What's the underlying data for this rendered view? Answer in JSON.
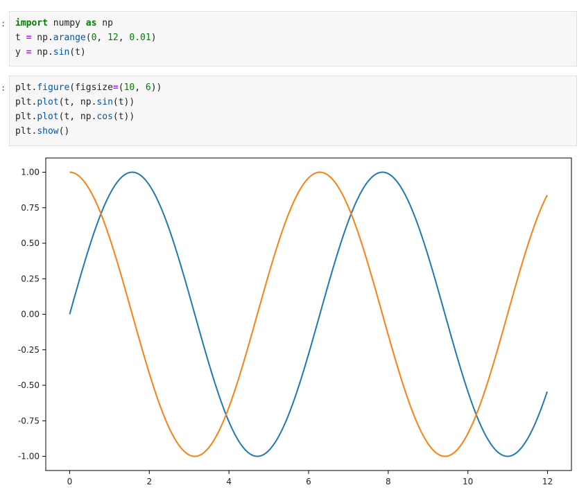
{
  "cells": [
    {
      "prompt": ":",
      "lines": [
        [
          {
            "t": "import",
            "c": "kw"
          },
          {
            "t": " numpy "
          },
          {
            "t": "as",
            "c": "kw"
          },
          {
            "t": " np"
          }
        ],
        [
          {
            "t": "t "
          },
          {
            "t": "=",
            "c": "op"
          },
          {
            "t": " np."
          },
          {
            "t": "arange",
            "c": "fn"
          },
          {
            "t": "("
          },
          {
            "t": "0",
            "c": "num"
          },
          {
            "t": ", "
          },
          {
            "t": "12",
            "c": "num"
          },
          {
            "t": ", "
          },
          {
            "t": "0.01",
            "c": "num"
          },
          {
            "t": ")"
          }
        ],
        [
          {
            "t": "y "
          },
          {
            "t": "=",
            "c": "op"
          },
          {
            "t": " np."
          },
          {
            "t": "sin",
            "c": "fn"
          },
          {
            "t": "(t)"
          }
        ]
      ]
    },
    {
      "prompt": ":",
      "lines": [
        [
          {
            "t": "plt."
          },
          {
            "t": "figure",
            "c": "fn"
          },
          {
            "t": "(figsize"
          },
          {
            "t": "=",
            "c": "op"
          },
          {
            "t": "("
          },
          {
            "t": "10",
            "c": "num"
          },
          {
            "t": ", "
          },
          {
            "t": "6",
            "c": "num"
          },
          {
            "t": "))"
          }
        ],
        [
          {
            "t": "plt."
          },
          {
            "t": "plot",
            "c": "fn"
          },
          {
            "t": "(t, np."
          },
          {
            "t": "sin",
            "c": "fn"
          },
          {
            "t": "(t))"
          }
        ],
        [
          {
            "t": "plt."
          },
          {
            "t": "plot",
            "c": "fn"
          },
          {
            "t": "(t, np."
          },
          {
            "t": "cos",
            "c": "fn"
          },
          {
            "t": "(t))"
          }
        ],
        [
          {
            "t": "plt."
          },
          {
            "t": "show",
            "c": "fn"
          },
          {
            "t": "()"
          }
        ]
      ]
    }
  ],
  "chart_data": {
    "type": "line",
    "title": "",
    "xlabel": "",
    "ylabel": "",
    "xlim": [
      -0.6,
      12.6
    ],
    "ylim": [
      -1.1,
      1.1
    ],
    "xticks": [
      0,
      2,
      4,
      6,
      8,
      10,
      12
    ],
    "xtick_labels": [
      "0",
      "2",
      "4",
      "6",
      "8",
      "10",
      "12"
    ],
    "yticks": [
      1.0,
      0.75,
      0.5,
      0.25,
      0.0,
      -0.25,
      -0.5,
      -0.75,
      -1.0
    ],
    "ytick_labels": [
      "1.00",
      "0.75",
      "0.50",
      "0.25",
      "0.00",
      "-0.25",
      "-0.50",
      "-0.75",
      "-1.00"
    ],
    "grid": false,
    "x_range": [
      0,
      12
    ],
    "x_step": 0.01,
    "series": [
      {
        "function": "sin",
        "color": "#1f77b4"
      },
      {
        "function": "cos",
        "color": "#ff7f0e"
      }
    ]
  }
}
